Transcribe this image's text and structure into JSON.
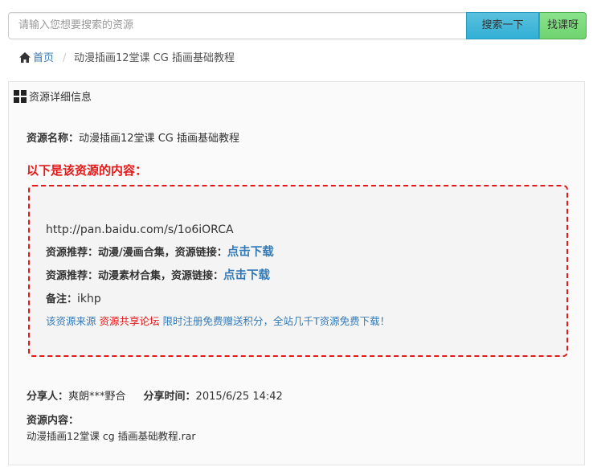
{
  "search": {
    "placeholder": "请输入您想要搜索的资源",
    "search_button": "搜索一下",
    "find_button": "找课呀"
  },
  "breadcrumb": {
    "home": "首页",
    "separator": "/",
    "current": "动漫插画12堂课 CG 插画基础教程"
  },
  "panel": {
    "heading": "资源详细信息",
    "resource_name_label": "资源名称：",
    "resource_name_value": "动漫插画12堂课 CG 插画基础教程",
    "content_title": "以下是该资源的内容：",
    "content": {
      "url": "http://pan.baidu.com/s/1o6iORCA",
      "rec1_label": "资源推荐：动漫/漫画合集，资源链接：",
      "rec1_link": "点击下载",
      "rec2_label": "资源推荐：动漫素材合集，资源链接：",
      "rec2_link": "点击下载",
      "note_label": "备注：",
      "note_value": "ikhp",
      "source_prefix": "该资源来源 ",
      "source_forum": "资源共享论坛",
      "source_suffix": " 限时注册免费赠送积分，全站几千T资源免费下载！"
    },
    "sharer_label": "分享人：",
    "sharer_value": "爽朗***野合",
    "share_time_label": "分享时间：",
    "share_time_value": "2015/6/25 14:42",
    "res_content_label": "资源内容：",
    "res_content_file": "动漫插画12堂课 cg 插画基础教程.rar"
  },
  "colors": {
    "accent_red": "#e61919",
    "link_blue": "#337ab7",
    "search_button": "#31b0d5",
    "find_button": "#5cb85c"
  },
  "icons": [
    "home-icon",
    "th-large-icon"
  ]
}
